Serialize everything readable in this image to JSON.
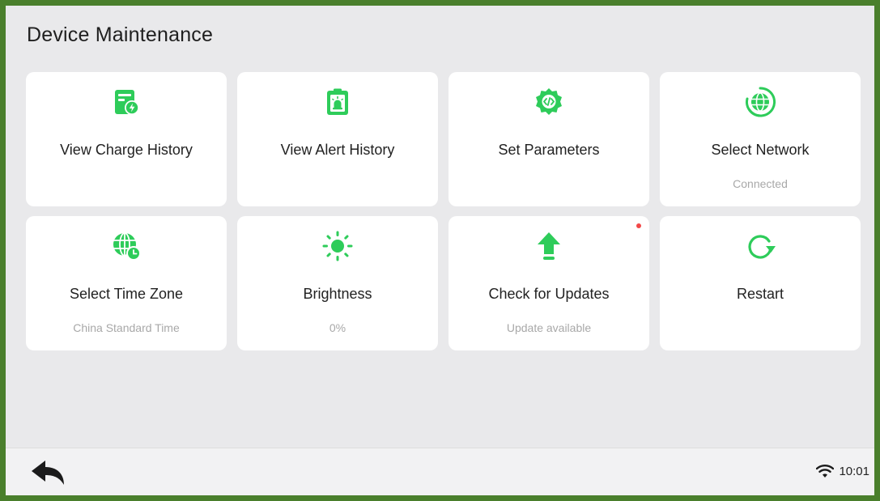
{
  "page": {
    "title": "Device Maintenance",
    "accent_color": "#2ecc5a",
    "frame_color": "#4a7f2c"
  },
  "tiles": [
    {
      "label": "View Charge History",
      "subtitle": "",
      "icon": "charge-history-icon"
    },
    {
      "label": "View Alert History",
      "subtitle": "",
      "icon": "alert-history-icon"
    },
    {
      "label": "Set Parameters",
      "subtitle": "",
      "icon": "settings-gear-icon"
    },
    {
      "label": "Select Network",
      "subtitle": "Connected",
      "icon": "network-globe-icon"
    },
    {
      "label": "Select Time Zone",
      "subtitle": "China Standard Time",
      "icon": "time-zone-globe-icon"
    },
    {
      "label": "Brightness",
      "subtitle": "0%",
      "icon": "sun-icon"
    },
    {
      "label": "Check for Updates",
      "subtitle": "Update available",
      "icon": "upload-arrow-icon",
      "notification_dot": true
    },
    {
      "label": "Restart",
      "subtitle": "",
      "icon": "restart-icon"
    }
  ],
  "status_bar": {
    "back_icon": "back-arrow-icon",
    "wifi_icon": "wifi-icon",
    "time": "10:01"
  }
}
